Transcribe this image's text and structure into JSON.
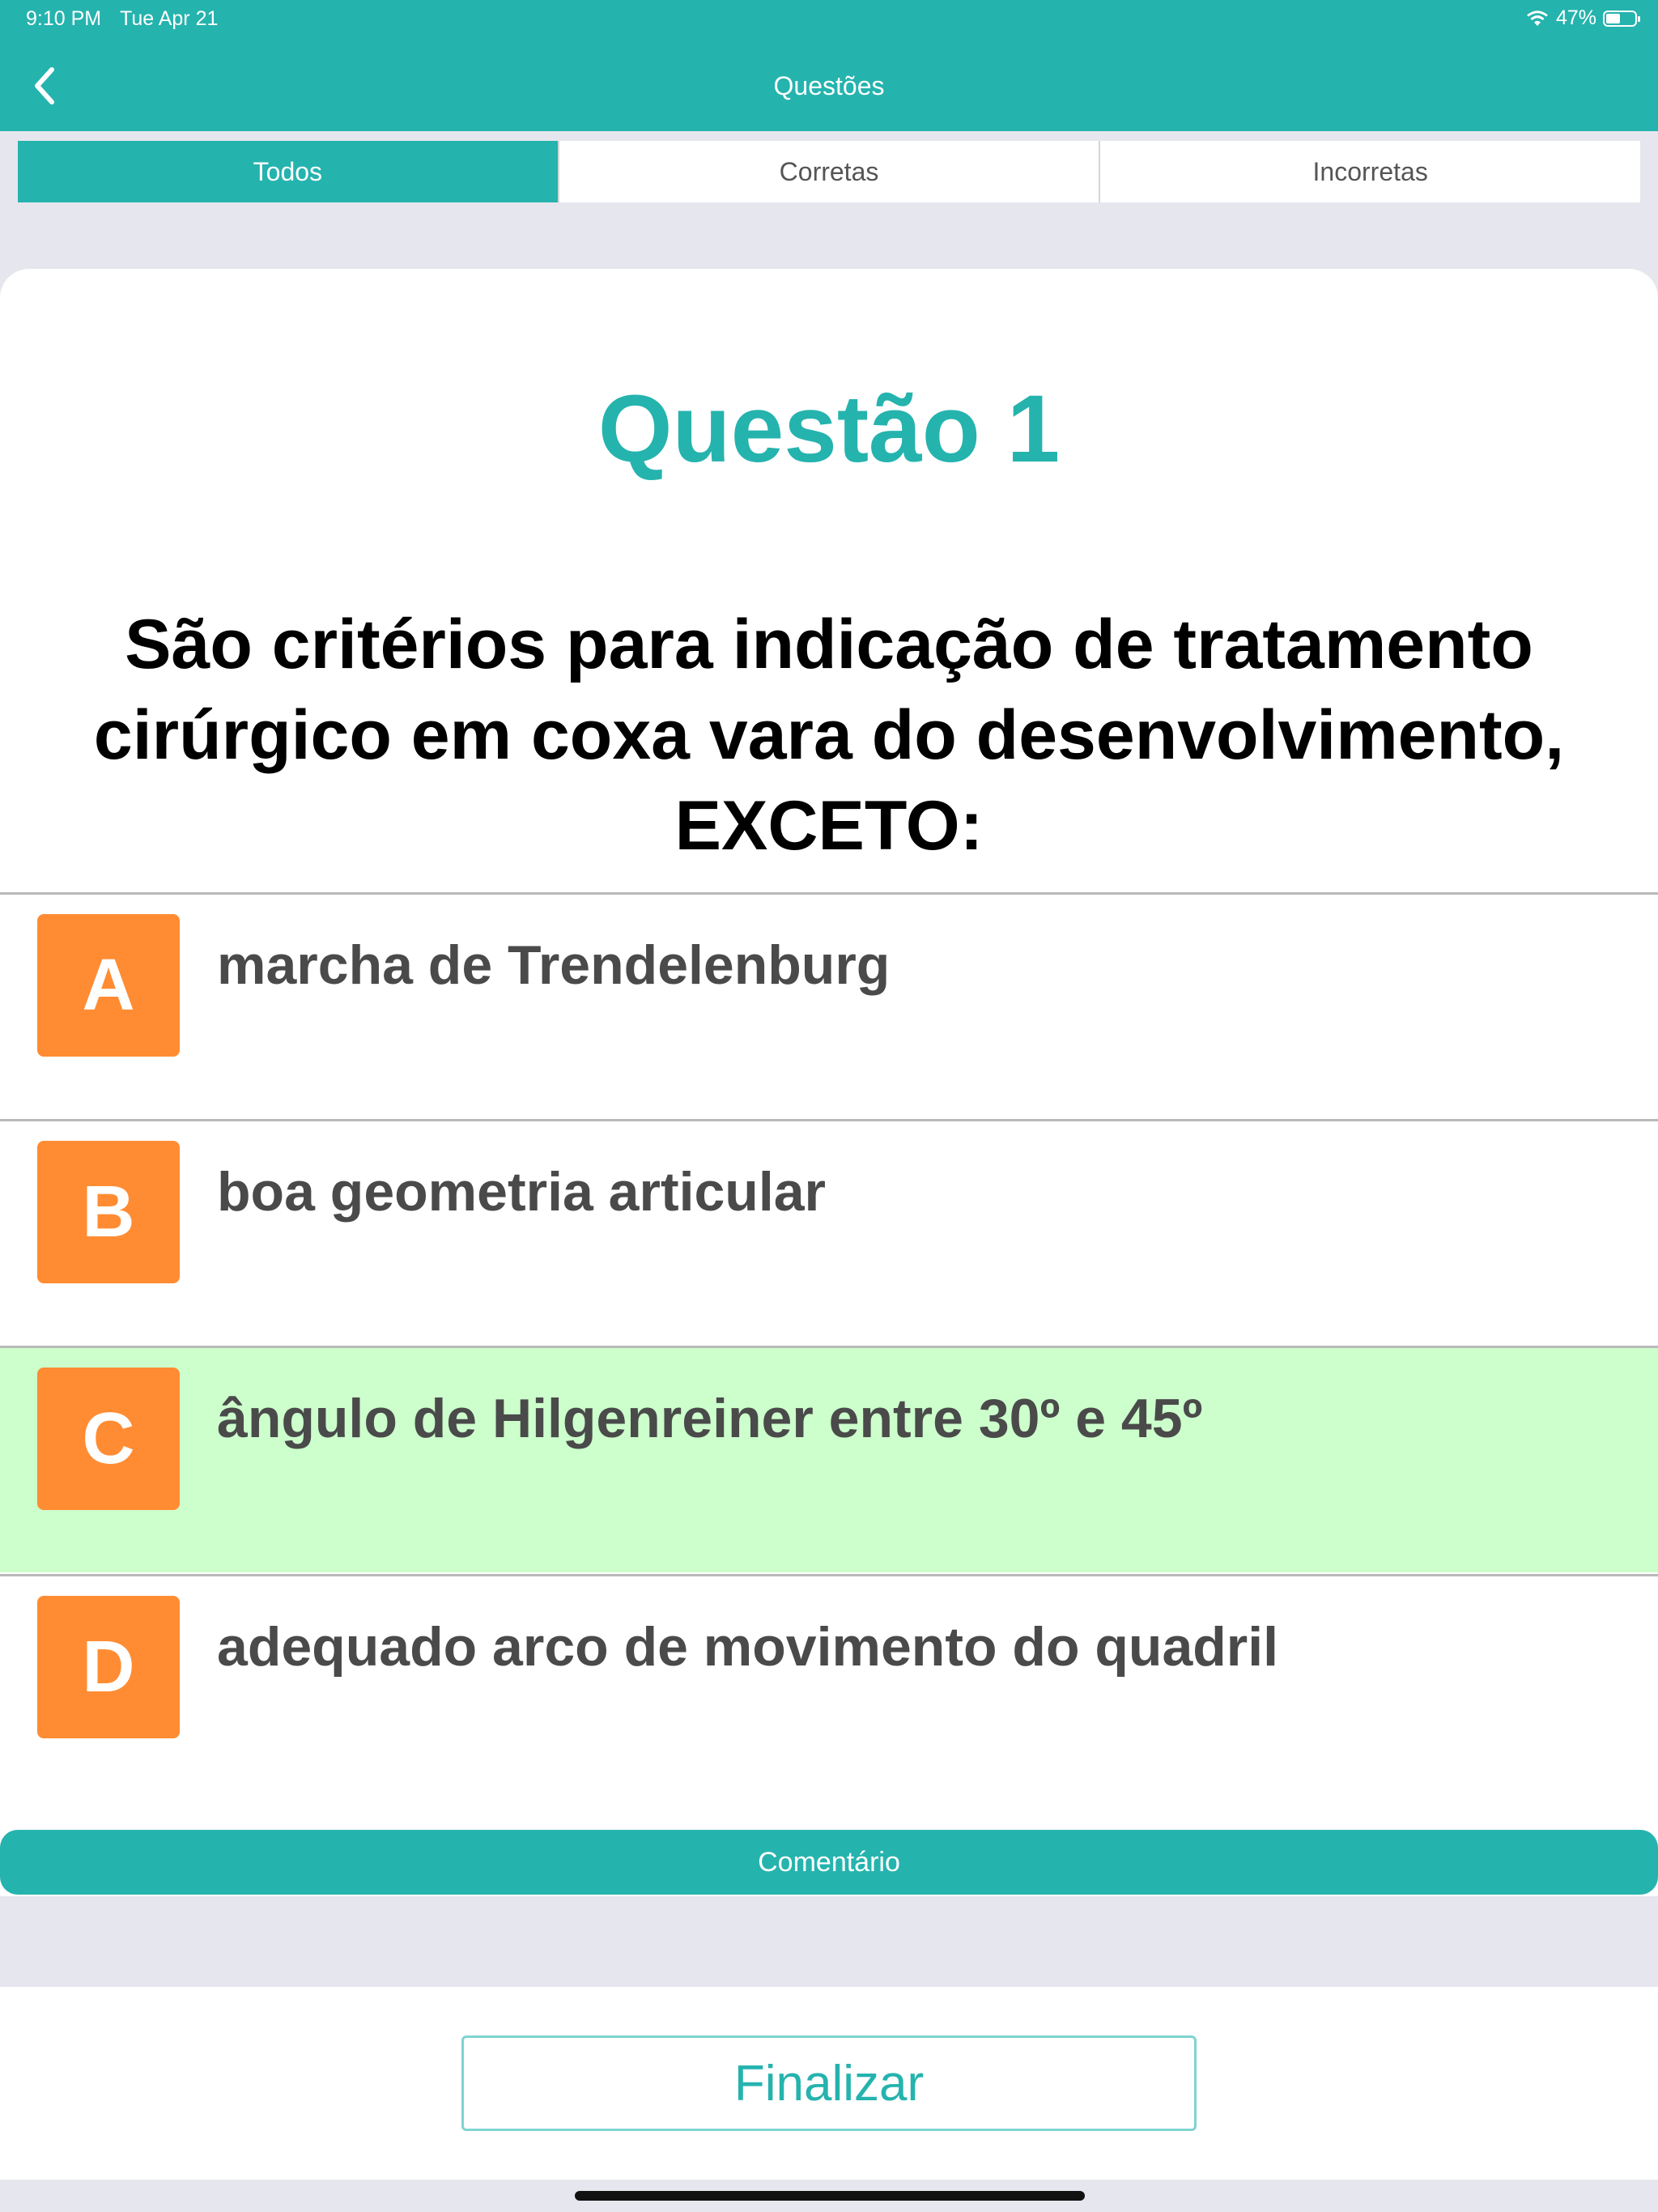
{
  "status_bar": {
    "time": "9:10 PM",
    "date": "Tue Apr 21",
    "battery": "47%",
    "battery_level": 0.47
  },
  "nav": {
    "title": "Questões",
    "back_icon": "chevron-left-icon"
  },
  "tabs": [
    {
      "label": "Todos",
      "active": true
    },
    {
      "label": "Corretas",
      "active": false
    },
    {
      "label": "Incorretas",
      "active": false
    }
  ],
  "question": {
    "title": "Questão 1",
    "text": "São critérios para indicação de tratamento cirúrgico em coxa vara do desenvolvimento, EXCETO:",
    "options": [
      {
        "letter": "A",
        "text": "marcha de Trendelenburg",
        "correct": false
      },
      {
        "letter": "B",
        "text": "boa geometria articular",
        "correct": false
      },
      {
        "letter": "C",
        "text": "ângulo de Hilgenreiner entre 30º e 45º",
        "correct": true
      },
      {
        "letter": "D",
        "text": "adequado arco de movimento do quadril",
        "correct": false
      }
    ]
  },
  "comment_label": "Comentário",
  "finish_label": "Finalizar",
  "colors": {
    "accent": "#25b3ae",
    "option_badge": "#ff8c33",
    "correct_bg": "#ccffcc"
  }
}
